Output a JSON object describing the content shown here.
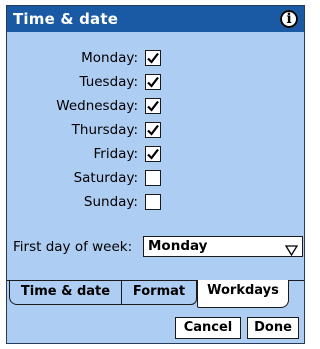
{
  "window": {
    "title": "Time & date",
    "info_icon": "info-icon"
  },
  "days": [
    {
      "label": "Monday:",
      "checked": true
    },
    {
      "label": "Tuesday:",
      "checked": true
    },
    {
      "label": "Wednesday:",
      "checked": true
    },
    {
      "label": "Thursday:",
      "checked": true
    },
    {
      "label": "Friday:",
      "checked": true
    },
    {
      "label": "Saturday:",
      "checked": false
    },
    {
      "label": "Sunday:",
      "checked": false
    }
  ],
  "first_day": {
    "label": "First day of week:",
    "value": "Monday"
  },
  "tabs": [
    {
      "label": "Time & date",
      "active": false
    },
    {
      "label": "Format",
      "active": false
    },
    {
      "label": "Workdays",
      "active": true
    }
  ],
  "buttons": {
    "cancel": "Cancel",
    "done": "Done"
  },
  "colors": {
    "background": "#aecdf2",
    "titlebar": "#1a59a3"
  }
}
